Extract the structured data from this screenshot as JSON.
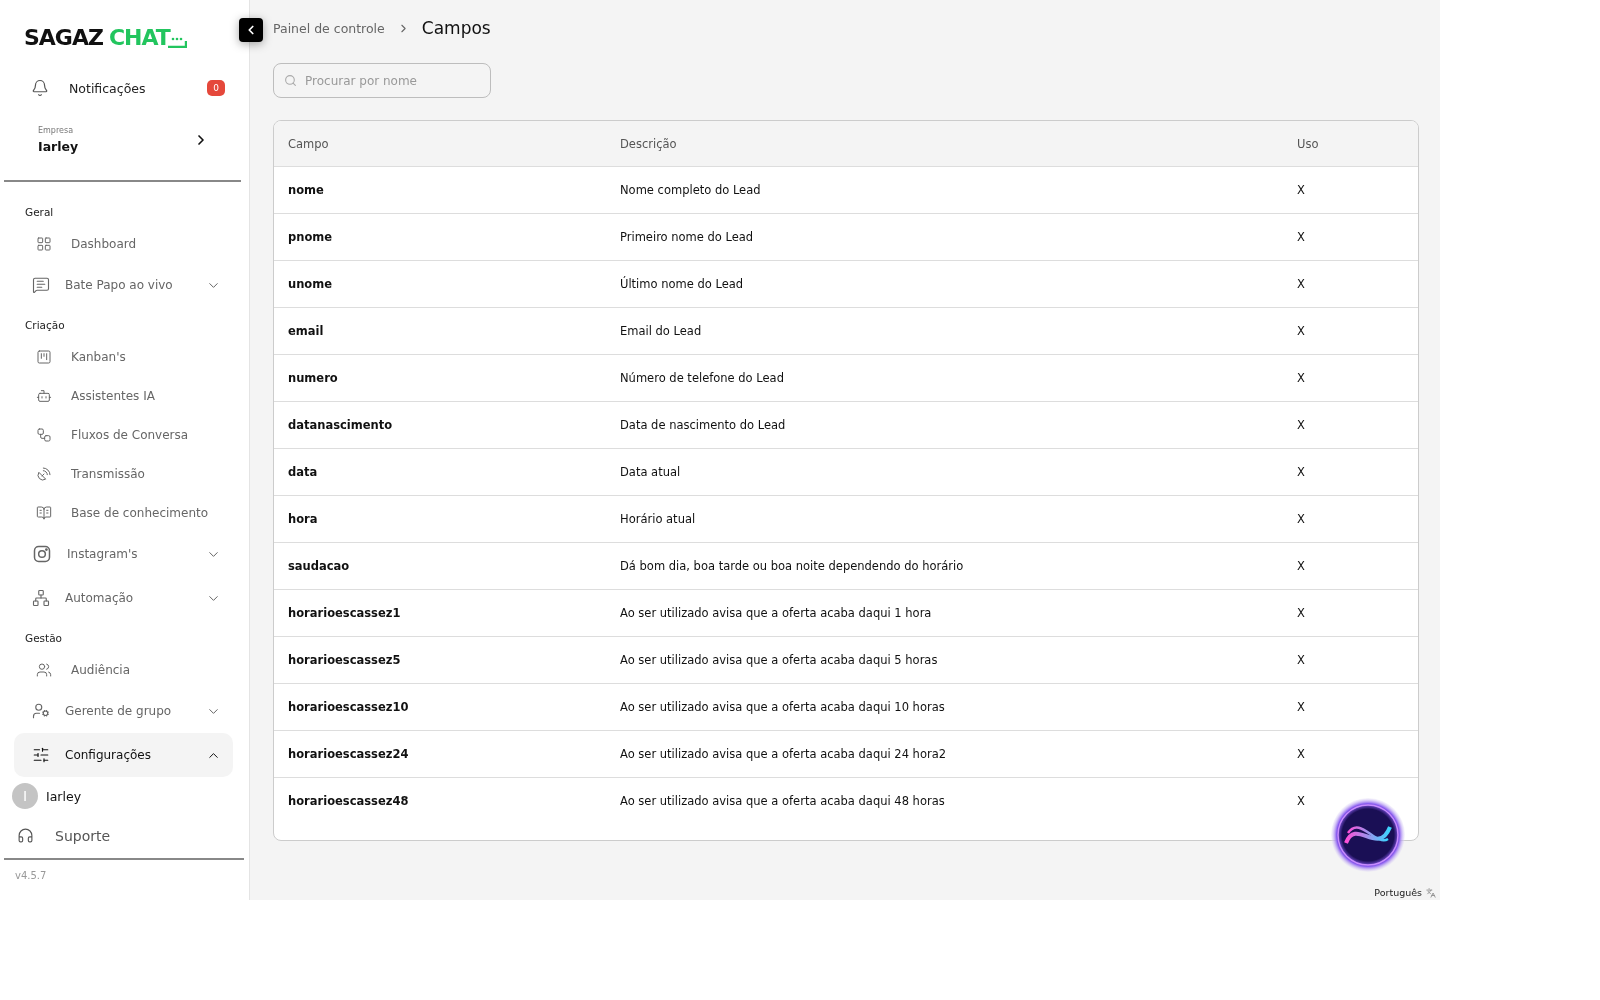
{
  "logo": {
    "part_1": "SAGAZ",
    "part_2": "CHAT"
  },
  "notifications": {
    "label": "Notificações",
    "count": "0"
  },
  "company": {
    "caption": "Empresa",
    "name": "Iarley"
  },
  "sidebar": {
    "sections": [
      {
        "title": "Geral",
        "items": [
          {
            "kind": "link",
            "label": "Dashboard"
          },
          {
            "kind": "group",
            "label": "Bate Papo ao vivo",
            "expanded": false
          }
        ]
      },
      {
        "title": "Criação",
        "items": [
          {
            "kind": "link",
            "label": "Kanban's"
          },
          {
            "kind": "link",
            "label": "Assistentes IA"
          },
          {
            "kind": "link",
            "label": "Fluxos de Conversa"
          },
          {
            "kind": "link",
            "label": "Transmissão"
          },
          {
            "kind": "link",
            "label": "Base de conhecimento"
          },
          {
            "kind": "group",
            "label": "Instagram's",
            "expanded": false
          },
          {
            "kind": "group",
            "label": "Automação",
            "expanded": false
          }
        ]
      },
      {
        "title": "Gestão",
        "items": [
          {
            "kind": "link",
            "label": "Audiência"
          },
          {
            "kind": "group",
            "label": "Gerente de grupo",
            "expanded": false
          },
          {
            "kind": "group",
            "label": "Configurações",
            "expanded": true
          }
        ]
      }
    ]
  },
  "user": {
    "initial": "I",
    "name": "Iarley"
  },
  "support": "Suporte",
  "version": "v4.5.7",
  "breadcrumb": {
    "parent": "Painel de controle",
    "current": "Campos"
  },
  "search": {
    "placeholder": "Procurar por nome"
  },
  "table": {
    "columns": [
      "Campo",
      "Descrição",
      "Uso"
    ],
    "rows": [
      [
        "nome",
        "Nome completo do Lead",
        "X"
      ],
      [
        "pnome",
        "Primeiro nome do Lead",
        "X"
      ],
      [
        "unome",
        "Último nome do Lead",
        "X"
      ],
      [
        "email",
        "Email do Lead",
        "X"
      ],
      [
        "numero",
        "Número de telefone do Lead",
        "X"
      ],
      [
        "datanascimento",
        "Data de nascimento do Lead",
        "X"
      ],
      [
        "data",
        "Data atual",
        "X"
      ],
      [
        "hora",
        "Horário atual",
        "X"
      ],
      [
        "saudacao",
        "Dá bom dia, boa tarde ou boa noite dependendo do horário",
        "X"
      ],
      [
        "horarioescassez1",
        "Ao ser utilizado avisa que a oferta acaba daqui 1 hora",
        "X"
      ],
      [
        "horarioescassez5",
        "Ao ser utilizado avisa que a oferta acaba daqui 5 horas",
        "X"
      ],
      [
        "horarioescassez10",
        "Ao ser utilizado avisa que a oferta acaba daqui 10 horas",
        "X"
      ],
      [
        "horarioescassez24",
        "Ao ser utilizado avisa que a oferta acaba daqui 24 hora2",
        "X"
      ],
      [
        "horarioescassez48",
        "Ao ser utilizado avisa que a oferta acaba daqui 48 horas",
        "X"
      ]
    ]
  },
  "language": "Português"
}
